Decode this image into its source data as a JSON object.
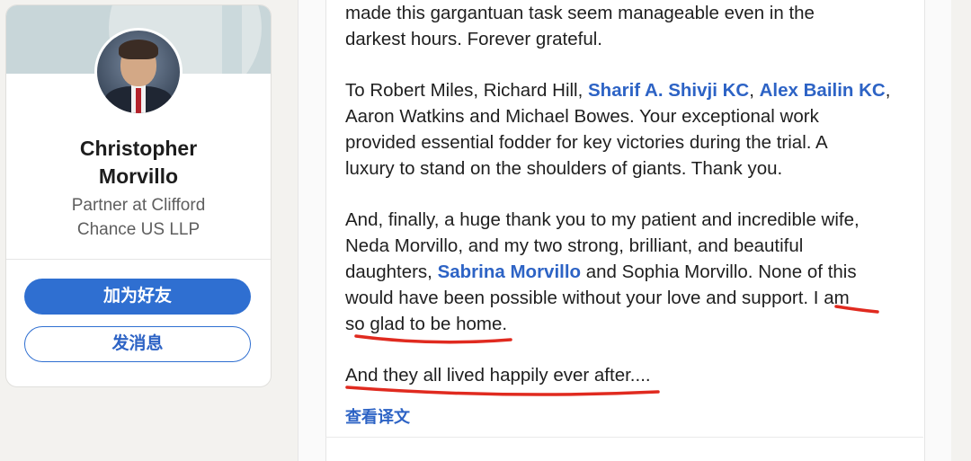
{
  "profile": {
    "name_line1": "Christopher",
    "name_line2": "Morvillo",
    "headline_line1": "Partner at Clifford",
    "headline_line2": "Chance US LLP",
    "connect_button": "加为好友",
    "message_button": "发消息"
  },
  "post": {
    "p1_line1": "made this gargantuan task seem manageable even in the",
    "p1_line2": "darkest hours. Forever grateful.",
    "p2_a": "To Robert Miles, Richard Hill, ",
    "p2_link1": "Sharif A. Shivji KC",
    "p2_sep": ", ",
    "p2_link2": "Alex Bailin KC",
    "p2_b": ",",
    "p2_line2": "Aaron Watkins and Michael Bowes. Your exceptional work",
    "p2_line3": "provided essential fodder for key victories during the trial. A",
    "p2_line4": "luxury to stand on the shoulders of giants. Thank you.",
    "p3_line1": "And, finally, a huge thank you to my patient and incredible wife,",
    "p3_line2": "Neda Morvillo, and my two strong, brilliant, and beautiful",
    "p3_line3_a": "daughters, ",
    "p3_link": "Sabrina Morvillo",
    "p3_line3_b": " and Sophia Morvillo.  None of this",
    "p3_line4": "would have been possible without your love and support. I am",
    "p3_line5": "so glad to be home.",
    "p4": "And they all lived happily ever after....",
    "translate_link": "查看译文"
  },
  "colors": {
    "link_blue": "#2d63c5",
    "annotation_red": "#e02a1f",
    "primary_button": "#2f6fd1"
  }
}
